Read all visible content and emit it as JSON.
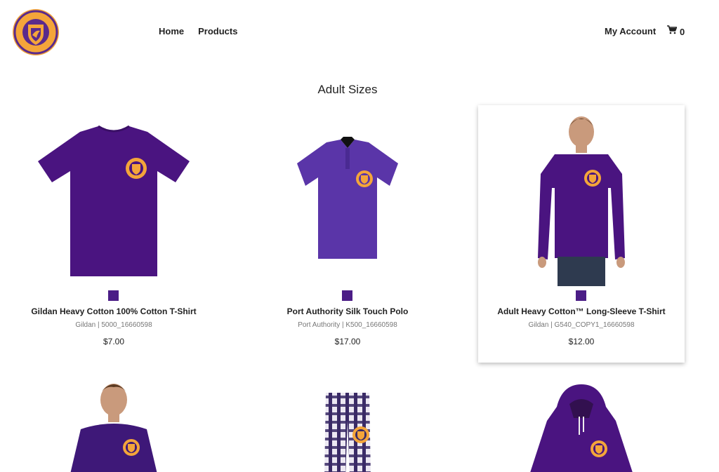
{
  "nav": {
    "home": "Home",
    "products": "Products"
  },
  "account": {
    "label": "My Account"
  },
  "cart": {
    "count": "0"
  },
  "section": {
    "title": "Adult Sizes"
  },
  "products": [
    {
      "name": "Gildan Heavy Cotton 100% Cotton T-Shirt",
      "meta": "Gildan | 5000_16660598",
      "price": "$7.00",
      "swatch": "#4b1d86"
    },
    {
      "name": "Port Authority Silk Touch Polo",
      "meta": "Port Authority | K500_16660598",
      "price": "$17.00",
      "swatch": "#4b1d86"
    },
    {
      "name": "Adult Heavy Cotton™ Long-Sleeve T-Shirt",
      "meta": "Gildan | G540_COPY1_16660598",
      "price": "$12.00",
      "swatch": "#4b1d86"
    }
  ],
  "colors": {
    "purple": "#4b1d86",
    "gold": "#f4a53a"
  }
}
